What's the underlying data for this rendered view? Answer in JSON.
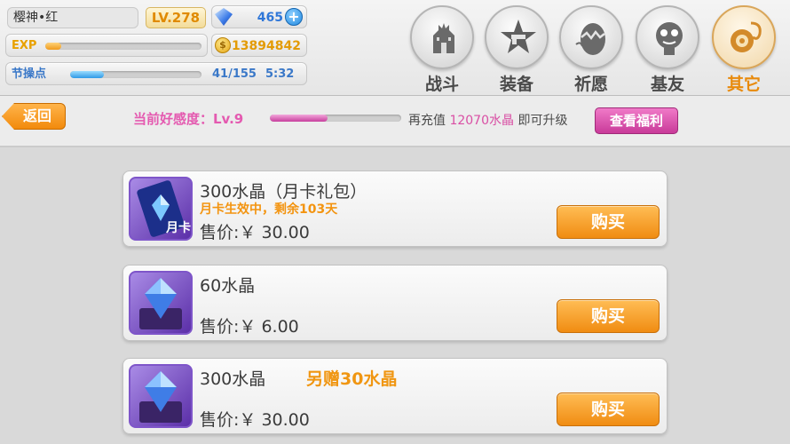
{
  "player": {
    "name": "樱神•红",
    "level": "LV.278",
    "crystals": "465",
    "exp_label": "EXP",
    "exp_progress": 0.1,
    "gold": "13894842",
    "gold_symbol": "$",
    "stamina_label": "节操点",
    "stamina_value": "41/155",
    "stamina_progress": 0.26,
    "timer": "5:32"
  },
  "nav": [
    {
      "label": "战斗",
      "icon": "castle-icon",
      "active": false
    },
    {
      "label": "装备",
      "icon": "star-gun-icon",
      "active": false
    },
    {
      "label": "祈愿",
      "icon": "egg-icon",
      "active": false
    },
    {
      "label": "基友",
      "icon": "friend-face-icon",
      "active": false
    },
    {
      "label": "其它",
      "icon": "settings-icon",
      "active": true
    }
  ],
  "subbar": {
    "back_label": "返回",
    "favor_label": "当前好感度：Lv.9",
    "favor_progress": 0.44,
    "recharge_prefix": "再充值",
    "recharge_amount": "12070水晶",
    "recharge_suffix": "即可升级",
    "welfare_label": "查看福利"
  },
  "products": [
    {
      "name": "300水晶（月卡礼包）",
      "bonus": "",
      "sub": "月卡生效中，剩余103天",
      "price": "售价:￥ 30.00",
      "buy_label": "购买",
      "icon": "monthly-card-icon",
      "icon_text": "月卡"
    },
    {
      "name": "60水晶",
      "bonus": "",
      "sub": "",
      "price": "售价:￥ 6.00",
      "buy_label": "购买",
      "icon": "crystal-icon",
      "icon_text": ""
    },
    {
      "name": "300水晶",
      "bonus": "另赠30水晶",
      "sub": "",
      "price": "售价:￥ 30.00",
      "buy_label": "购买",
      "icon": "crystal-icon",
      "icon_text": ""
    }
  ],
  "colors": {
    "accent_orange": "#f08c12",
    "favor_pink": "#e45ab0",
    "crystal_blue": "#2f77d8",
    "gold": "#e39b06"
  }
}
